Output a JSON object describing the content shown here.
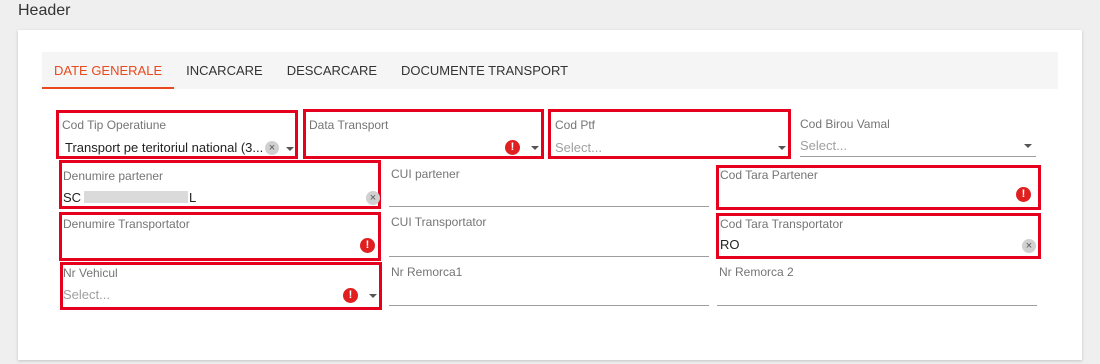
{
  "page": {
    "title": "Header"
  },
  "tabs": [
    {
      "label": "DATE GENERALE"
    },
    {
      "label": "INCARCARE"
    },
    {
      "label": "DESCARCARE"
    },
    {
      "label": "DOCUMENTE TRANSPORT"
    }
  ],
  "fields": {
    "cod_tip_operatiune": {
      "label": "Cod Tip Operatiune",
      "value": "Transport pe teritoriul national (3..."
    },
    "data_transport": {
      "label": "Data Transport",
      "value": ""
    },
    "cod_ptf": {
      "label": "Cod Ptf",
      "placeholder": "Select..."
    },
    "cod_birou_vamal": {
      "label": "Cod Birou Vamal",
      "placeholder": "Select..."
    },
    "denumire_partener": {
      "label": "Denumire partener",
      "value_prefix": "SC",
      "value_suffix": "L"
    },
    "cui_partener": {
      "label": "CUI partener",
      "value": ""
    },
    "cod_tara_partener": {
      "label": "Cod Tara Partener",
      "value": ""
    },
    "denumire_transportator": {
      "label": "Denumire Transportator",
      "value": ""
    },
    "cui_transportator": {
      "label": "CUI Transportator",
      "value": ""
    },
    "cod_tara_transportator": {
      "label": "Cod Tara Transportator",
      "value": "RO"
    },
    "nr_vehicul": {
      "label": "Nr Vehicul",
      "placeholder": "Select..."
    },
    "nr_remorca1": {
      "label": "Nr Remorca1",
      "value": ""
    },
    "nr_remorca2": {
      "label": "Nr Remorca 2",
      "value": ""
    }
  },
  "icons": {
    "clear": "×",
    "error": "!"
  },
  "colors": {
    "accent": "#e8491d",
    "error": "#e5001d"
  }
}
